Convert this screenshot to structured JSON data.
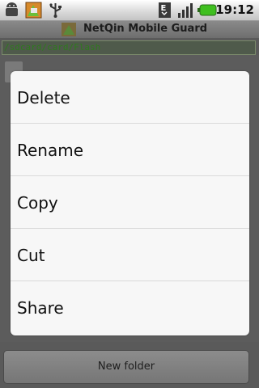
{
  "status_bar": {
    "time": "19:12",
    "icons": [
      "android-debug-icon",
      "app-notification-icon",
      "usb-icon",
      "edge-data-icon",
      "signal-icon",
      "battery-icon"
    ]
  },
  "app": {
    "title": "NetQin Mobile Guard"
  },
  "path": {
    "text": "/sdcard/card/Flash"
  },
  "context_menu": {
    "items": [
      {
        "label": "Delete"
      },
      {
        "label": "Rename"
      },
      {
        "label": "Copy"
      },
      {
        "label": "Cut"
      },
      {
        "label": "Share"
      }
    ]
  },
  "bottom": {
    "new_folder_label": "New folder"
  },
  "colors": {
    "menu_bg": "#f7f7f7",
    "dim_overlay": "#5a5a5a",
    "path_text": "#2f7a1e",
    "battery": "#3fbf1f"
  }
}
